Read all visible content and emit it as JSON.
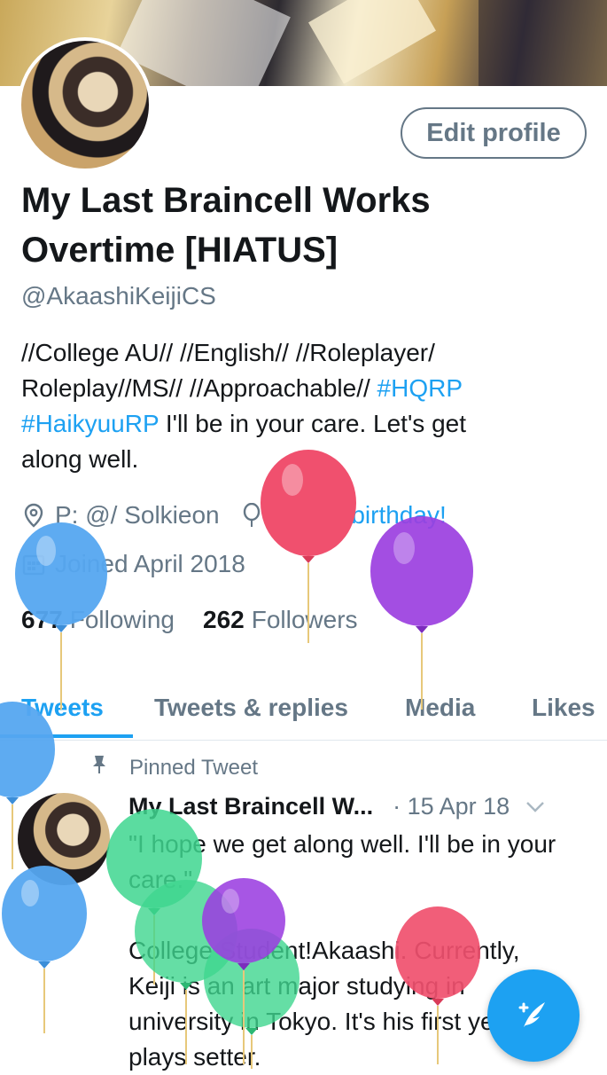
{
  "profile": {
    "edit_label": "Edit profile",
    "name_line1": "My Last Braincell Works",
    "name_line2": "Overtime [HIATUS]",
    "handle": "@AkaashiKeijiCS",
    "bio_line1": "//College AU// //English// //Roleplayer/",
    "bio_line2_text": "Roleplay//MS// //Approachable// ",
    "bio_tag1": "#HQRP",
    "bio_tag2": "#HaikyuuRP",
    "bio_line3_text": " I'll be in your care. Let's get",
    "bio_line4": "along well.",
    "location": "P: @/ Solkieon",
    "birthday": "Happy birthday!",
    "joined": "Joined April 2018",
    "following_count": "677",
    "following_label": "Following",
    "followers_count": "262",
    "followers_label": "Followers"
  },
  "tabs": [
    "Tweets",
    "Tweets & replies",
    "Media",
    "Likes"
  ],
  "pinned_tweet": {
    "pinned_label": "Pinned Tweet",
    "author": "My Last Braincell W...",
    "date": "· 15 Apr 18",
    "body": "\"I hope we get along well. I'll be in your care.\"\n\nCollege Student!Akaashi. Currently, Keiji is an art major studying in university in Tokyo. It's his first year. Still plays setter."
  },
  "colors": {
    "accent": "#1da1f2",
    "secondary_text": "#657786",
    "primary_text": "#14171a",
    "balloon_red": "#f0506e",
    "balloon_blue": "#55a7f0",
    "balloon_purple": "#9b3fe0",
    "balloon_green": "#3ed68f"
  },
  "icons": {
    "location": "map-pin-icon",
    "birthday": "balloon-icon",
    "joined": "calendar-icon",
    "pinned": "pin-icon",
    "compose": "feather-compose-icon",
    "more": "chevron-down-icon"
  }
}
